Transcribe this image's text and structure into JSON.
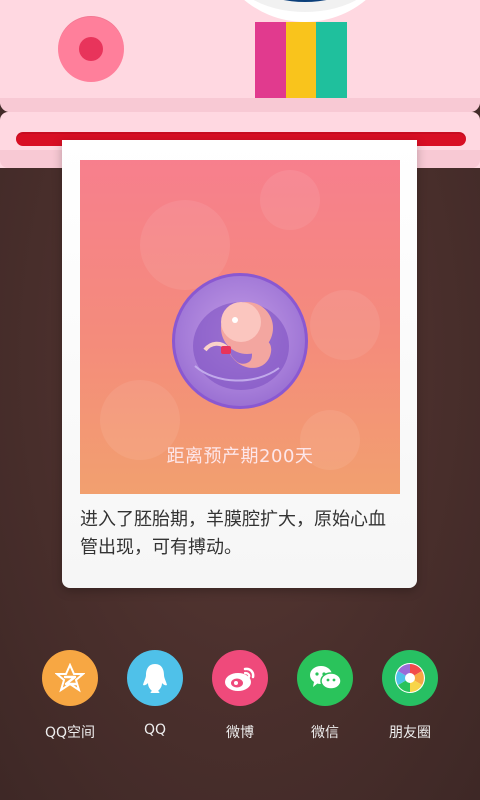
{
  "card": {
    "countdown_text": "距离预产期200天",
    "description": "进入了胚胎期，羊膜腔扩大，原始心血管出现，可有搏动。"
  },
  "share": {
    "items": [
      {
        "label": "QQ空间",
        "icon": "qzone-icon",
        "color": "#f7a743"
      },
      {
        "label": "QQ",
        "icon": "qq-icon",
        "color": "#4fc1e9"
      },
      {
        "label": "微博",
        "icon": "weibo-icon",
        "color": "#ef4a7b"
      },
      {
        "label": "微信",
        "icon": "wechat-icon",
        "color": "#2ac35b"
      },
      {
        "label": "朋友圈",
        "icon": "moments-icon",
        "color": "#27c063"
      }
    ]
  },
  "colors": {
    "stripe_1": "#e13a8e",
    "stripe_2": "#f9c41c",
    "stripe_3": "#1fc09d",
    "lens": "#0b3f7a",
    "slot_red": "#d80f24"
  }
}
